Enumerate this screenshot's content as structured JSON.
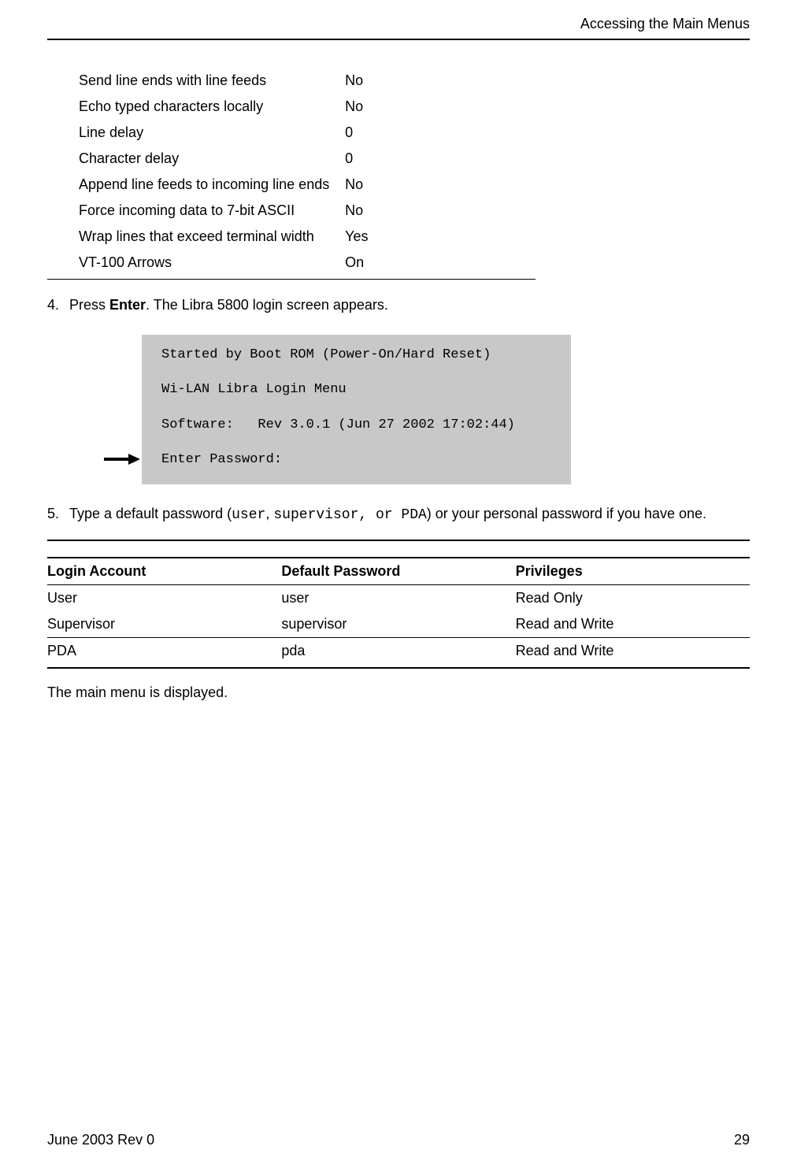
{
  "header": {
    "section_title": "Accessing the Main Menus"
  },
  "settings": [
    {
      "label": "Send line ends with line feeds",
      "value": "No"
    },
    {
      "label": "Echo typed characters locally",
      "value": "No"
    },
    {
      "label": "Line delay",
      "value": "0"
    },
    {
      "label": "Character delay",
      "value": "0"
    },
    {
      "label": "Append line feeds to incoming line ends",
      "value": "No"
    },
    {
      "label": "Force incoming data to 7-bit ASCII",
      "value": "No"
    },
    {
      "label": "Wrap lines that exceed terminal width",
      "value": "Yes"
    },
    {
      "label": "VT-100 Arrows",
      "value": "On"
    }
  ],
  "step4": {
    "num": "4.",
    "pre": "Press ",
    "bold": "Enter",
    "post": ". The Libra 5800 login screen appears."
  },
  "terminal": {
    "line1": "Started by Boot ROM (Power-On/Hard Reset)",
    "line2": "",
    "line3": "Wi-LAN Libra Login Menu",
    "line4": "",
    "line5": "Software:   Rev 3.0.1 (Jun 27 2002 17:02:44)",
    "line6": "",
    "line7": "Enter Password:"
  },
  "step5": {
    "num": "5.",
    "pre": "Type a default password (",
    "mono1": "user",
    "mid1": ", ",
    "mono2": "supervisor, or PDA",
    "post": ") or your personal password if you have one."
  },
  "login_table": {
    "headers": {
      "c1": "Login Account",
      "c2": "Default Password",
      "c3": "Privileges"
    },
    "rows": [
      {
        "c1": "User",
        "c2": "user",
        "c3": "Read Only"
      },
      {
        "c1": "Supervisor",
        "c2": "supervisor",
        "c3": "Read and Write"
      },
      {
        "c1": "PDA",
        "c2": "pda",
        "c3": "Read and Write"
      }
    ]
  },
  "body_after": "The main menu is displayed.",
  "footer": {
    "left": "June 2003 Rev 0",
    "right": "29"
  }
}
